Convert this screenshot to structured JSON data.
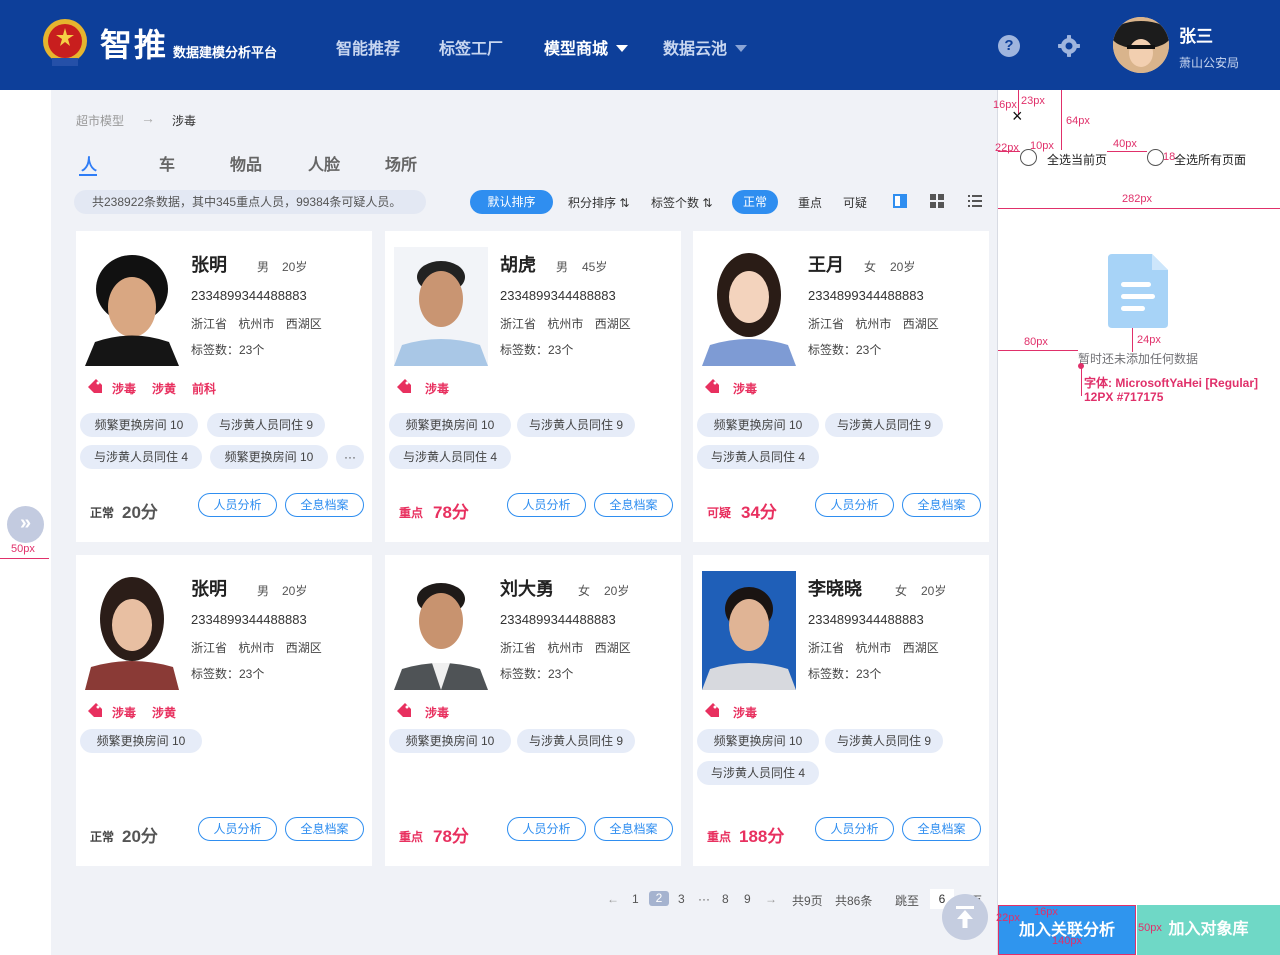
{
  "header": {
    "brand_title": "智推",
    "brand_sub": "数据建模分析平台",
    "nav": [
      {
        "label": "智能推荐",
        "active": false
      },
      {
        "label": "标签工厂",
        "active": false
      },
      {
        "label": "模型商城",
        "active": true
      },
      {
        "label": "数据云池",
        "active": false
      }
    ],
    "help_glyph": "?",
    "user_name": "张三",
    "user_org": "萧山公安局"
  },
  "breadcrumb": {
    "root": "超市模型",
    "arrow": "→",
    "current": "涉毒"
  },
  "category_tabs": [
    "人",
    "车",
    "物品",
    "人脸",
    "场所"
  ],
  "summary": "共238922条数据，其中345重点人员，99384条可疑人员。",
  "sort": {
    "default": "默认排序",
    "score": "积分排序",
    "tag_count": "标签个数"
  },
  "filter": {
    "normal": "正常",
    "key": "重点",
    "suspect": "可疑"
  },
  "cards": [
    {
      "name": "张明",
      "gender": "男",
      "age": "20岁",
      "id": "2334899344488883",
      "province": "浙江省",
      "city": "杭州市",
      "district": "西湖区",
      "tag_count": "标签数：23个",
      "tags": [
        "涉毒",
        "涉黄",
        "前科"
      ],
      "chips": [
        "频繁更换房间 10",
        "与涉黄人员同住 9",
        "与涉黄人员同住 4",
        "频繁更换房间 10",
        "···"
      ],
      "status": "正常",
      "score": "20分",
      "btn1": "人员分析",
      "btn2": "全息档案"
    },
    {
      "name": "胡虎",
      "gender": "男",
      "age": "45岁",
      "id": "2334899344488883",
      "province": "浙江省",
      "city": "杭州市",
      "district": "西湖区",
      "tag_count": "标签数：23个",
      "tags": [
        "涉毒"
      ],
      "chips": [
        "频繁更换房间 10",
        "与涉黄人员同住 9",
        "与涉黄人员同住 4"
      ],
      "status": "重点",
      "score": "78分",
      "btn1": "人员分析",
      "btn2": "全息档案"
    },
    {
      "name": "王月",
      "gender": "女",
      "age": "20岁",
      "id": "2334899344488883",
      "province": "浙江省",
      "city": "杭州市",
      "district": "西湖区",
      "tag_count": "标签数：23个",
      "tags": [
        "涉毒"
      ],
      "chips": [
        "频繁更换房间 10",
        "与涉黄人员同住 9",
        "与涉黄人员同住 4"
      ],
      "status": "可疑",
      "score": "34分",
      "btn1": "人员分析",
      "btn2": "全息档案"
    },
    {
      "name": "张明",
      "gender": "男",
      "age": "20岁",
      "id": "2334899344488883",
      "province": "浙江省",
      "city": "杭州市",
      "district": "西湖区",
      "tag_count": "标签数：23个",
      "tags": [
        "涉毒",
        "涉黄"
      ],
      "chips": [
        "频繁更换房间 10"
      ],
      "status": "正常",
      "score": "20分",
      "btn1": "人员分析",
      "btn2": "全息档案"
    },
    {
      "name": "刘大勇",
      "gender": "女",
      "age": "20岁",
      "id": "2334899344488883",
      "province": "浙江省",
      "city": "杭州市",
      "district": "西湖区",
      "tag_count": "标签数：23个",
      "tags": [
        "涉毒"
      ],
      "chips": [
        "频繁更换房间 10",
        "与涉黄人员同住 9"
      ],
      "status": "重点",
      "score": "78分",
      "btn1": "人员分析",
      "btn2": "全息档案"
    },
    {
      "name": "李晓晓",
      "gender": "女",
      "age": "20岁",
      "id": "2334899344488883",
      "province": "浙江省",
      "city": "杭州市",
      "district": "西湖区",
      "tag_count": "标签数：23个",
      "tags": [
        "涉毒"
      ],
      "chips": [
        "频繁更换房间 10",
        "与涉黄人员同住 9",
        "与涉黄人员同住 4"
      ],
      "status": "重点",
      "score": "188分",
      "btn1": "人员分析",
      "btn2": "全息档案"
    }
  ],
  "pagination": {
    "prev": "←",
    "pages": [
      "1",
      "2",
      "3",
      "···",
      "8",
      "9"
    ],
    "current": "2",
    "next": "→",
    "total_pages": "共9页",
    "total_items": "共86条",
    "jump": "跳至",
    "jump_value": "6",
    "page_suffix": "页"
  },
  "left_expand": "»",
  "side_panel": {
    "close": "×",
    "select_current": "全选当前页",
    "select_all": "全选所有页面",
    "empty_text": "暂时还未添加任何数据",
    "font_note_1": "字体: MicrosoftYaHei [Regular]",
    "font_note_2": "12PX #717175",
    "annotations": {
      "a16": "16px",
      "a23": "23px",
      "a64": "64px",
      "a22": "22px",
      "a10": "10px",
      "a40": "40px",
      "a18": "18",
      "a282": "282px",
      "a80": "80px",
      "a24": "24px",
      "a50": "50px",
      "b22": "22px",
      "b16": "16px",
      "b140": "140px",
      "b50": "50px"
    },
    "btn_link": "加入关联分析",
    "btn_lib": "加入对象库"
  },
  "colors": {
    "header_bg": "#0d3f9a",
    "accent": "#2f8ef0",
    "tag_red": "#e8305f",
    "main_bg": "#f0f2f7",
    "btn_teal": "#6fd8c6",
    "annotation": "#e0306a"
  }
}
